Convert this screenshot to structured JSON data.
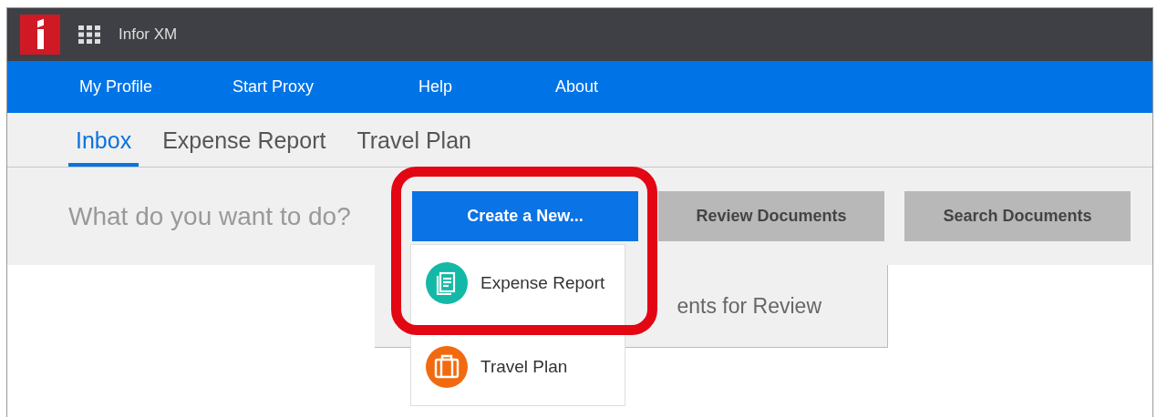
{
  "app": {
    "title": "Infor XM"
  },
  "nav_links": [
    "My Profile",
    "Start Proxy",
    "Help",
    "About"
  ],
  "tabs": [
    {
      "label": "Inbox",
      "selected": true
    },
    {
      "label": "Expense Report",
      "selected": false
    },
    {
      "label": "Travel Plan",
      "selected": false
    }
  ],
  "prompt": "What do you want to do?",
  "actions": [
    {
      "label": "Create a New...",
      "kind": "primary"
    },
    {
      "label": "Review Documents",
      "kind": "secondary"
    },
    {
      "label": "Search Documents",
      "kind": "secondary"
    }
  ],
  "create_menu": [
    {
      "label": "Expense Report",
      "kind": "expense",
      "color": "#14b8a6"
    },
    {
      "label": "Travel Plan",
      "kind": "travel",
      "color": "#f26a10"
    }
  ],
  "panel_tab": "ents for Review",
  "highlight": {
    "color": "#e30613"
  }
}
